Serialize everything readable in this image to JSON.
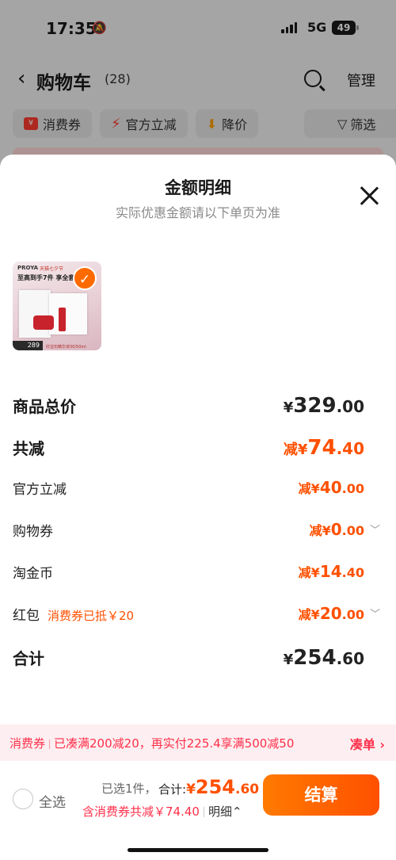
{
  "status": {
    "time": "17:35",
    "network": "5G",
    "battery": "49"
  },
  "nav": {
    "back": "‹",
    "title": "购物车",
    "count": "(28)",
    "manage": "管理"
  },
  "filters": {
    "coupon": "消费券",
    "coupon_icon": "¥",
    "official": "官方立减",
    "price_drop": "降价",
    "filter": "筛选"
  },
  "sheet": {
    "title": "金额明细",
    "subtitle": "实际优惠金额请以下单页为准",
    "product": {
      "brand": "PROYA",
      "brand_tag": "天猫七夕节",
      "promo": "至高到手7件 享全套搭",
      "price_tag": "289",
      "caption": "红宝石精华液30/50ml"
    },
    "rows": [
      {
        "label": "商品总价",
        "prefix": "",
        "currency": "¥",
        "int": "329",
        "dec": ".00"
      },
      {
        "label": "共减",
        "prefix": "减",
        "currency": "¥",
        "int": "74",
        "dec": ".40"
      },
      {
        "label": "官方立减",
        "prefix": "减",
        "currency": "¥",
        "int": "40",
        "dec": ".00"
      },
      {
        "label": "购物券",
        "prefix": "减",
        "currency": "¥",
        "int": "0",
        "dec": ".00"
      },
      {
        "label": "淘金币",
        "prefix": "减",
        "currency": "¥",
        "int": "14",
        "dec": ".40"
      },
      {
        "label": "红包",
        "note": "消费券已抵￥20",
        "prefix": "减",
        "currency": "¥",
        "int": "20",
        "dec": ".00"
      },
      {
        "label": "合计",
        "prefix": "",
        "currency": "¥",
        "int": "254",
        "dec": ".60"
      }
    ]
  },
  "banner": {
    "tag": "消费券",
    "text": "已凑满200减20，再实付225.4享满500减50",
    "action": "凑单 ›"
  },
  "bottom": {
    "select_all": "全选",
    "selected": "已选1件，",
    "total_label": "合计:",
    "total_currency": "¥",
    "total_int": "254",
    "total_dec": ".60",
    "discount_note": "含消费券共减￥74.40",
    "detail": "明细⌃",
    "checkout": "结算"
  },
  "colors": {
    "accent": "#ff5000",
    "checkout_start": "#ff7a00",
    "banner_bg": "#fdeff1",
    "banner_text": "#ff2f4a"
  }
}
